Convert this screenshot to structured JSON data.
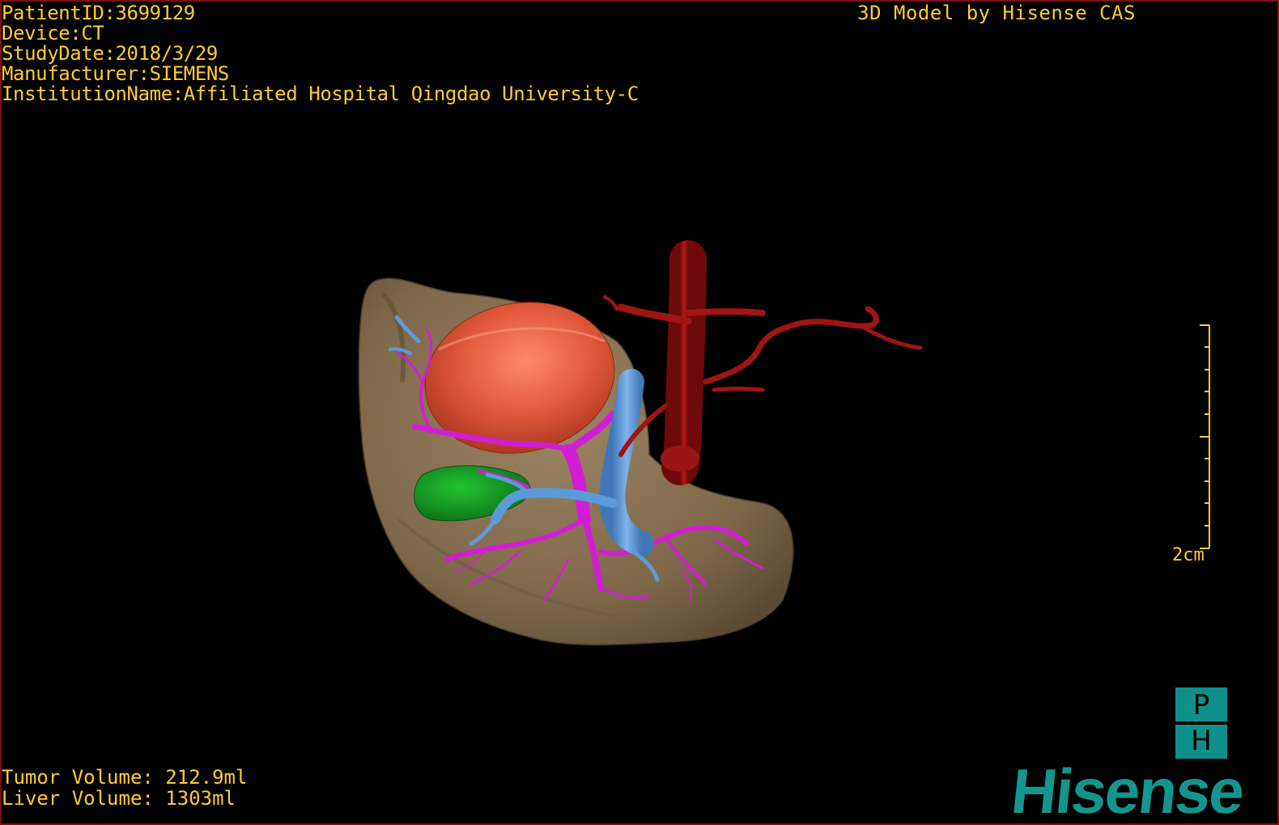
{
  "patient_info": {
    "patient_id": "PatientID:3699129",
    "device": "Device:CT",
    "study_date": "StudyDate:2018/3/29",
    "manufacturer": "Manufacturer:SIEMENS",
    "institution": "InstitutionName:Affiliated Hospital Qingdao University-C"
  },
  "model_credit": "3D Model by Hisense CAS",
  "volumes": {
    "tumor": "Tumor Volume: 212.9ml",
    "liver": "Liver Volume: 1303ml"
  },
  "scale_bar": {
    "label": "2cm"
  },
  "ph_logo": {
    "top_letter": "P",
    "bottom_letter": "H"
  },
  "brand": "Hisense",
  "colors": {
    "overlay_text": "#ffcc33",
    "liver": "#8a7457",
    "tumor": "#e05a3a",
    "artery": "#a01414",
    "portal_vein": "#d21ed2",
    "hepatic_vein": "#5b9bd8",
    "gallbladder": "#159a22",
    "brand": "#14968f"
  }
}
